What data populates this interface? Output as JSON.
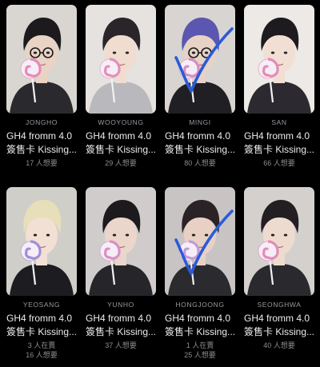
{
  "cards": [
    {
      "member": "JONGHO",
      "title_line1": "GH4 fromm 4.0",
      "title_line2": "簽售卡 Kissing...",
      "meta_lines": [
        "17 人想要"
      ],
      "checked": false,
      "colors": {
        "bg": "#d9d6d1",
        "hair": "#1c1a1c",
        "skin": "#e9d3c4",
        "cloth": "#2a2a2e",
        "lolly": "#e58bb5"
      },
      "glasses": true
    },
    {
      "member": "WOOYOUNG",
      "title_line1": "GH4 fromm 4.0",
      "title_line2": "簽售卡 Kissing...",
      "meta_lines": [
        "29 人想要"
      ],
      "checked": false,
      "colors": {
        "bg": "#e5e2df",
        "hair": "#2a2528",
        "skin": "#f0ddd0",
        "cloth": "#b9b9bd",
        "lolly": "#e48fb8"
      },
      "glasses": false
    },
    {
      "member": "MINGI",
      "title_line1": "GH4 fromm 4.0",
      "title_line2": "簽售卡 Kissing...",
      "meta_lines": [
        "80 人想要"
      ],
      "checked": true,
      "colors": {
        "bg": "#d8d4d2",
        "hair": "#5b56b0",
        "skin": "#e7d2c6",
        "cloth": "#201f23",
        "lolly": "#d98cc4"
      },
      "glasses": true
    },
    {
      "member": "SAN",
      "title_line1": "GH4 fromm 4.0",
      "title_line2": "簽售卡 Kissing...",
      "meta_lines": [
        "66 人想要"
      ],
      "checked": false,
      "colors": {
        "bg": "#ece9e6",
        "hair": "#1e1b1e",
        "skin": "#f1dfd4",
        "cloth": "#2c2a30",
        "lolly": "#e58bb5"
      },
      "glasses": false
    },
    {
      "member": "YEOSANG",
      "title_line1": "GH4 fromm 4.0",
      "title_line2": "簽售卡 Kissing...",
      "meta_lines": [
        "3 人在賣",
        "16 人想要"
      ],
      "checked": false,
      "colors": {
        "bg": "#d0cec9",
        "hair": "#e7dfb9",
        "skin": "#f1e0d3",
        "cloth": "#1d1c20",
        "lolly": "#9f8fd6"
      },
      "glasses": false
    },
    {
      "member": "YUNHO",
      "title_line1": "GH4 fromm 4.0",
      "title_line2": "簽售卡 Kissing...",
      "meta_lines": [
        "37 人想要"
      ],
      "checked": false,
      "colors": {
        "bg": "#cfcccb",
        "hair": "#1c1a1d",
        "skin": "#ead6ca",
        "cloth": "#26252a",
        "lolly": "#d98fc4"
      },
      "glasses": false
    },
    {
      "member": "HONGJOONG",
      "title_line1": "GH4 fromm 4.0",
      "title_line2": "簽售卡 Kissing...",
      "meta_lines": [
        "1 人在賣",
        "25 人想要"
      ],
      "checked": true,
      "colors": {
        "bg": "#c9c4c4",
        "hair": "#2a2226",
        "skin": "#e8d1c4",
        "cloth": "#2b2a2f",
        "lolly": "#c39ad8"
      },
      "glasses": false
    },
    {
      "member": "SEONGHWA",
      "title_line1": "GH4 fromm 4.0",
      "title_line2": "簽售卡 Kissing...",
      "meta_lines": [
        "40 人想要"
      ],
      "checked": false,
      "colors": {
        "bg": "#d3d0ce",
        "hair": "#221e22",
        "skin": "#eedbd0",
        "cloth": "#2a292d",
        "lolly": "#e38cb8"
      },
      "glasses": false
    }
  ],
  "check_color": "#2a5bd7"
}
